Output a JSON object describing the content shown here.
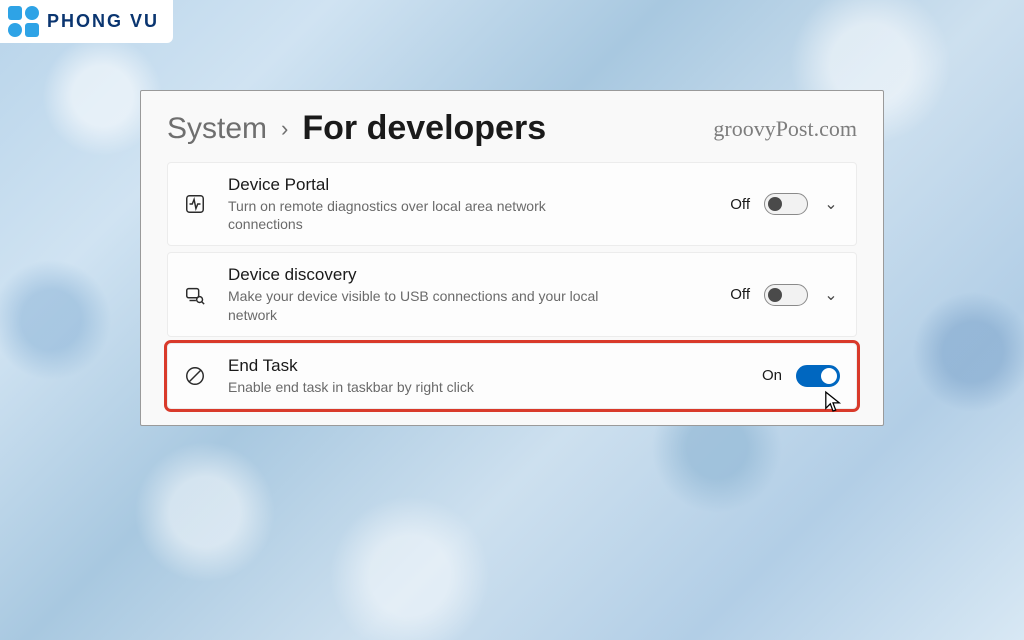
{
  "logo": {
    "text": "PHONG VU"
  },
  "watermark": "groovyPost.com",
  "breadcrumb": {
    "parent": "System",
    "page": "For developers"
  },
  "settings": [
    {
      "icon": "activity-icon",
      "title": "Device Portal",
      "desc": "Turn on remote diagnostics over local area network connections",
      "state_label": "Off",
      "toggle_on": false,
      "expandable": true,
      "highlight": false
    },
    {
      "icon": "device-search-icon",
      "title": "Device discovery",
      "desc": "Make your device visible to USB connections and your local network",
      "state_label": "Off",
      "toggle_on": false,
      "expandable": true,
      "highlight": false
    },
    {
      "icon": "prohibit-icon",
      "title": "End Task",
      "desc": "Enable end task in taskbar by right click",
      "state_label": "On",
      "toggle_on": true,
      "expandable": false,
      "highlight": true
    }
  ]
}
